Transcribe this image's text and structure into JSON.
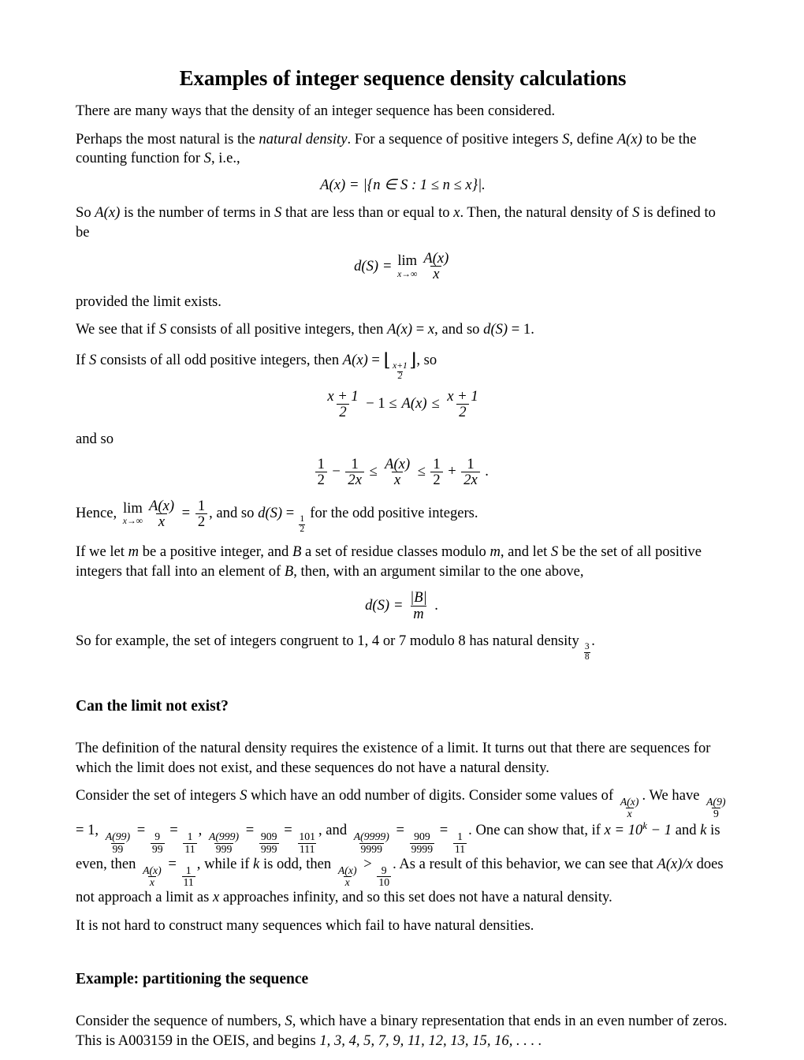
{
  "document": {
    "title": "Examples of integer sequence density calculations",
    "intro": {
      "p1": "There are many ways that the density of an integer sequence has been considered.",
      "p2_a": "Perhaps the most natural is the ",
      "p2_em": "natural density",
      "p2_b": ". For a sequence of positive integers ",
      "p2_s": "S",
      "p2_c": ", define ",
      "p2_ax": "A(x)",
      "p2_d": " to be the counting function for ",
      "p2_s2": "S",
      "p2_e": ", i.e.,"
    },
    "eq_counting": {
      "lhs": "A(x)",
      "eq": "=",
      "rhs": "|{n ∈ S : 1 ≤ n ≤ x}|."
    },
    "para_after_counting": {
      "a": "So ",
      "ax": "A(x)",
      "b": " is the number of terms in ",
      "s": "S",
      "c": " that are less than or equal to ",
      "x": "x",
      "d": ". Then, the natural density of ",
      "s2": "S",
      "e": " is defined to be"
    },
    "eq_density": {
      "lhs": "d(S)",
      "eq": "=",
      "lim_op": "lim",
      "lim_sub": "x→∞",
      "num": "A(x)",
      "den": "x"
    },
    "para_provided": "provided the limit exists.",
    "para_allpos": {
      "a": "We see that if ",
      "s": "S",
      "b": " consists of all positive integers, then ",
      "ax": "A(x)",
      "c": " = ",
      "x": "x",
      "d": ", and so ",
      "ds": "d(S)",
      "e": " = 1."
    },
    "para_odd": {
      "a": "If ",
      "s": "S",
      "b": " consists of all odd positive integers, then ",
      "ax": "A(x)",
      "c": " = ",
      "floor_open": "⌊",
      "floor_num": "x+1",
      "floor_den": "2",
      "floor_close": "⌋",
      "d": ", so"
    },
    "eq_oddbound": {
      "num1": "x + 1",
      "den1": "2",
      "minus": "− 1 ≤",
      "mid": "A(x)",
      "le": "≤",
      "num2": "x + 1",
      "den2": "2"
    },
    "para_andso": "and so",
    "eq_andso": {
      "t1_num": "1",
      "t1_den": "2",
      "minus": "−",
      "t2_num": "1",
      "t2_den": "2x",
      "le1": "≤",
      "t3_num": "A(x)",
      "t3_den": "x",
      "le2": "≤",
      "t4_num": "1",
      "t4_den": "2",
      "plus": "+",
      "t5_num": "1",
      "t5_den": "2x",
      "period": "."
    },
    "para_hence": {
      "a": "Hence, ",
      "lim_op": "lim",
      "lim_sub": "x→∞",
      "num": "A(x)",
      "den": "x",
      "b": " = ",
      "half_num": "1",
      "half_den": "2",
      "c": ", and so ",
      "ds": "d(S)",
      "d": " = ",
      "half2_num": "1",
      "half2_den": "2",
      "e": " for the odd positive integers."
    },
    "para_residue": {
      "a": "If we let ",
      "m": "m",
      "b": " be a positive integer, and ",
      "B": "B",
      "c": " a set of residue classes modulo ",
      "m2": "m",
      "d": ", and let ",
      "S": "S",
      "e": " be the set of all positive integers that fall into an element of ",
      "B2": "B",
      "f": ", then, with an argument similar to the one above,"
    },
    "eq_residue": {
      "lhs": "d(S)",
      "eq": "=",
      "num": "|B|",
      "den": "m",
      "period": "."
    },
    "para_example_mod": {
      "a": "So for example, the set of integers congruent to 1, 4 or 7 modulo 8 has natural density ",
      "frac_num": "3",
      "frac_den": "8",
      "b": "."
    },
    "sections": [
      {
        "id": "limit-not-exist",
        "heading": "Can the limit not exist?",
        "p1": "The definition of the natural density requires the existence of a limit. It turns out that there are sequences for which the limit does not exist, and these sequences do not have a natural density.",
        "p2": {
          "a": "Consider the set of integers ",
          "S": "S",
          "b": " which have an odd number of digits. Consider some values of ",
          "ratio_num": "A(x)",
          "ratio_den": "x",
          "c": ". We have ",
          "f1_num": "A(9)",
          "f1_den": "9",
          "eq1": " = 1, ",
          "f2_num": "A(99)",
          "f2_den": "99",
          "eq2": " = ",
          "f3_num": "9",
          "f3_den": "99",
          "eq3": " = ",
          "f4_num": "1",
          "f4_den": "11",
          "eq4": ", ",
          "f5_num": "A(999)",
          "f5_den": "999",
          "eq5": " = ",
          "f6_num": "909",
          "f6_den": "999",
          "eq6": " = ",
          "f7_num": "101",
          "f7_den": "111",
          "eq7": ", and ",
          "f8_num": "A(9999)",
          "f8_den": "9999",
          "eq8": " = ",
          "f9_num": "909",
          "f9_den": "9999",
          "eq9": " = ",
          "f10_num": "1",
          "f10_den": "11",
          "eq10": ". One can show that, if ",
          "xeq": "x = 10",
          "kexp": "k",
          "xeq2": " − 1",
          "d": " and ",
          "k": "k",
          "e": " is even, then ",
          "f11_num": "A(x)",
          "f11_den": "x",
          "eq11": " = ",
          "f12_num": "1",
          "f12_den": "11",
          "eq12": ", while if ",
          "k2": "k",
          "f": " is odd, then ",
          "f13_num": "A(x)",
          "f13_den": "x",
          "gt": " > ",
          "f14_num": "9",
          "f14_den": "10",
          "g": ". As a result of this behavior, we can see that ",
          "axx": "A(x)/x",
          "h": " does not approach a limit as ",
          "x2": "x",
          "i": " approaches infinity, and so this set does not have a natural density."
        },
        "p3": "It is not hard to construct many sequences which fail to have natural densities."
      },
      {
        "id": "partitioning",
        "heading": "Example: partitioning the sequence",
        "p1": {
          "a": "Consider the sequence of numbers, ",
          "S": "S",
          "b": ", which have a binary representation that ends in an even number of zeros. This is A003159 in the OEIS, and begins ",
          "sequence": "1, 3, 4, 5, 7, 9, 11, 12, 13, 15, 16, . . . ."
        }
      }
    ]
  }
}
